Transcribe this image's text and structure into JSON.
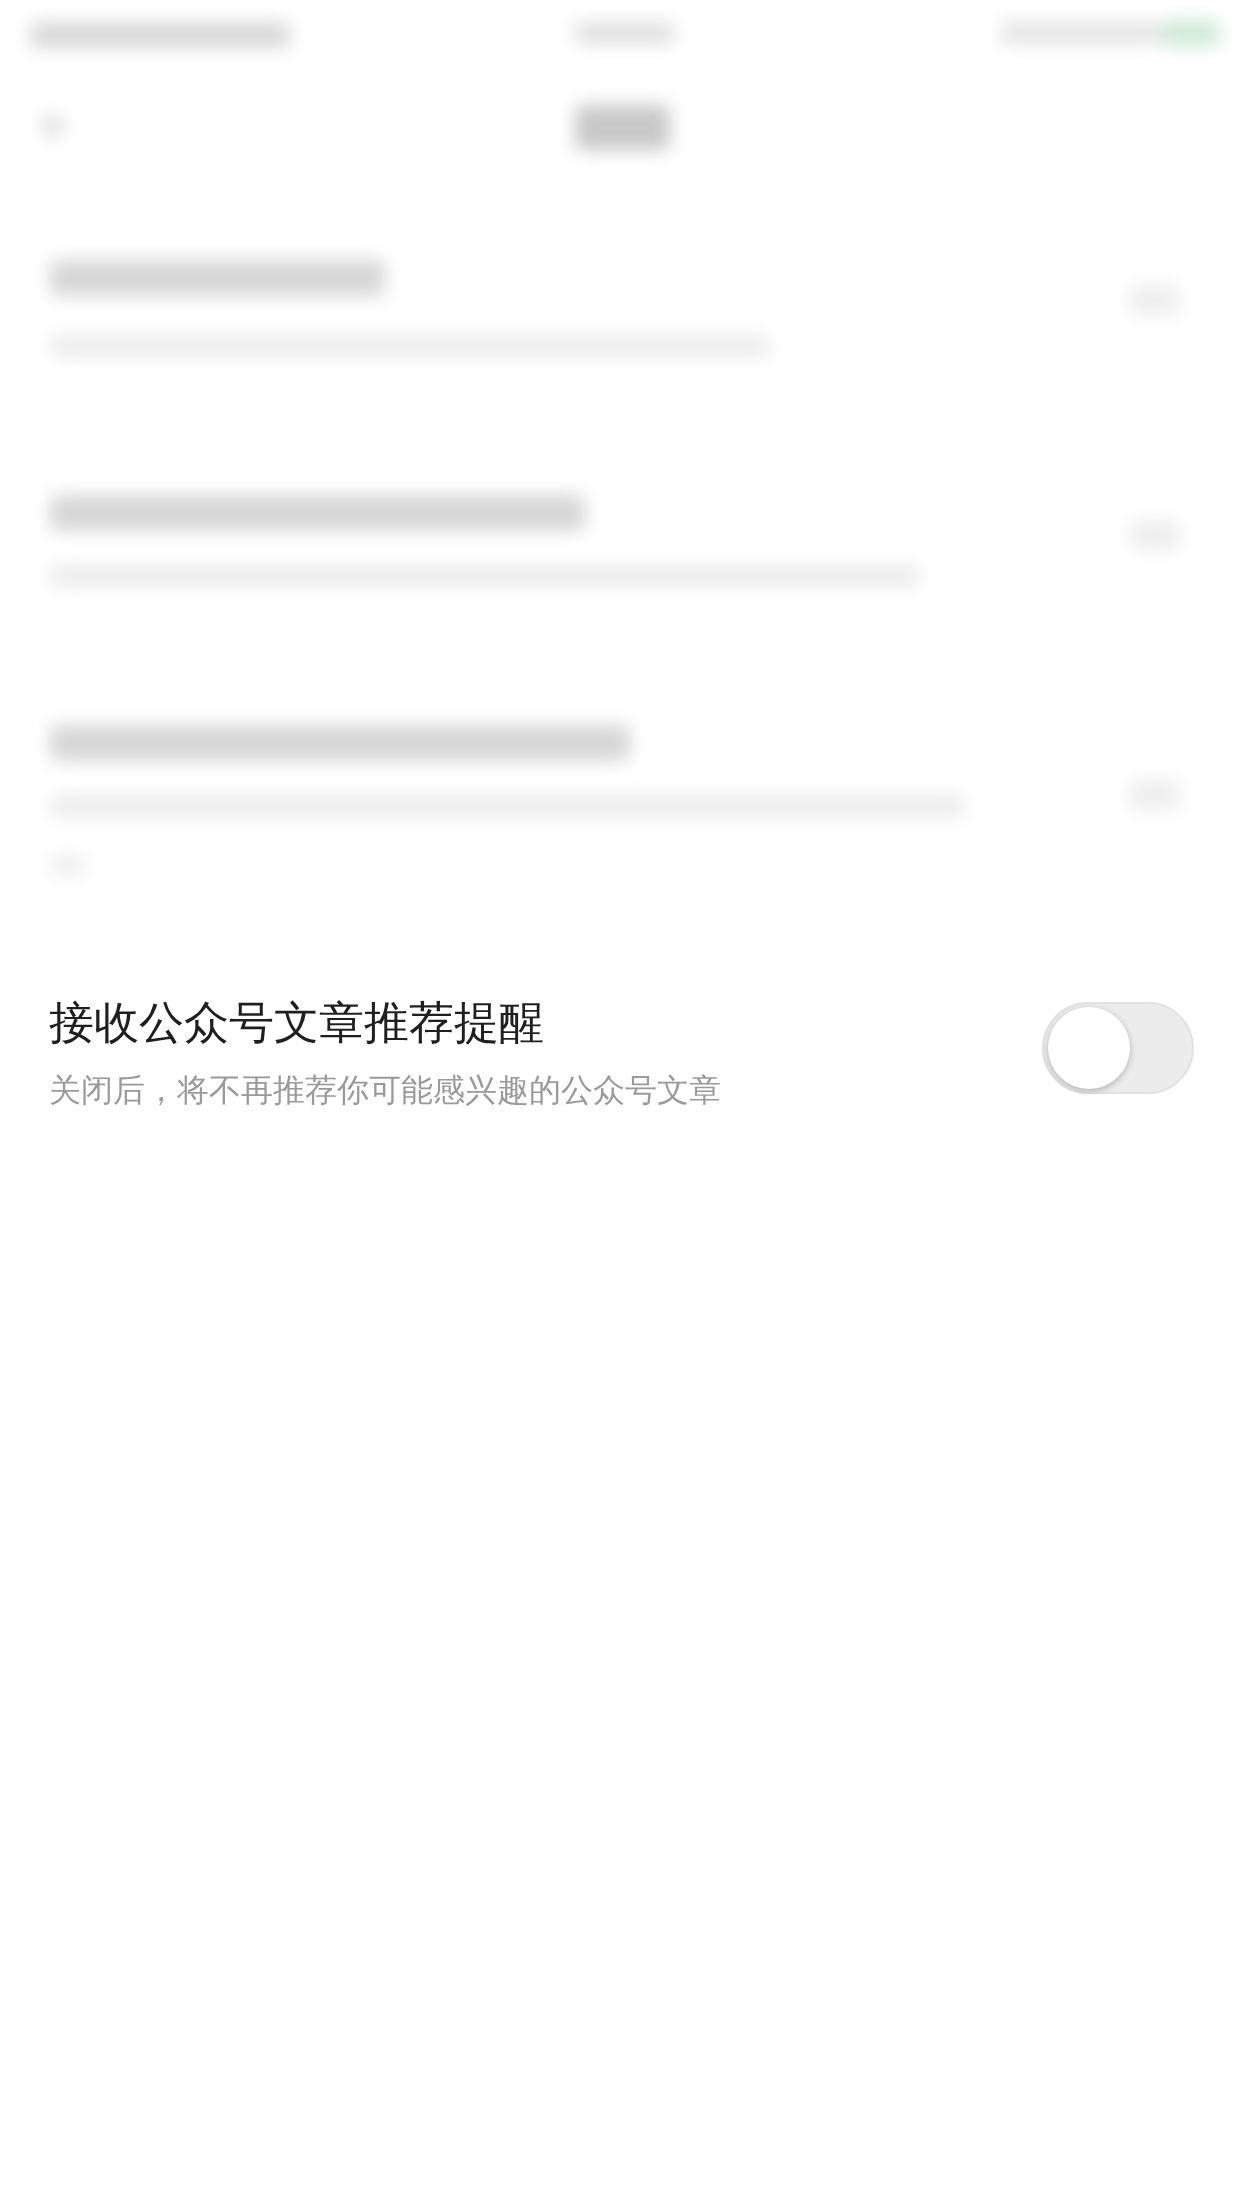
{
  "setting": {
    "title": "接收公众号文章推荐提醒",
    "subtitle": "关闭后，将不再推荐你可能感兴趣的公众号文章",
    "on": false
  }
}
